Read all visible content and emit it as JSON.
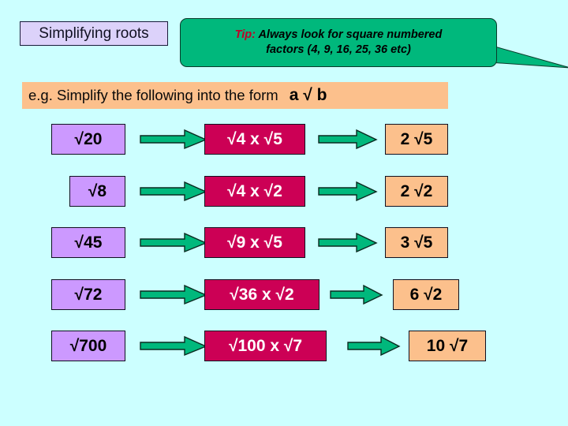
{
  "slide": {
    "background_color": "#CCFFFF",
    "title": "Simplifying roots",
    "callout": {
      "tip_label": "Tip:",
      "line1_rest": " Always look for square numbered",
      "line2": "factors (4, 9, 16, 25, 36 etc)",
      "fill_color": "#00B87C",
      "tip_color": "#C00028"
    },
    "instruction": {
      "text": "e.g. Simplify the following into the form",
      "form": "a √ b",
      "background_color": "#FCC08C"
    },
    "colors": {
      "start_box": "#CC99FF",
      "mid_box": "#CC0055",
      "end_box": "#FCC08C",
      "arrow": "#00B87C",
      "title_box": "#DCD2FA"
    },
    "rows": [
      {
        "start": "√20",
        "middle": "√4 x √5",
        "result": "2 √5"
      },
      {
        "start": "√8",
        "middle": "√4 x √2",
        "result": "2 √2"
      },
      {
        "start": "√45",
        "middle": "√9 x √5",
        "result": "3 √5"
      },
      {
        "start": "√72",
        "middle": "√36 x √2",
        "result": "6 √2"
      },
      {
        "start": "√700",
        "middle": "√100 x √7",
        "result": "10 √7"
      }
    ]
  }
}
